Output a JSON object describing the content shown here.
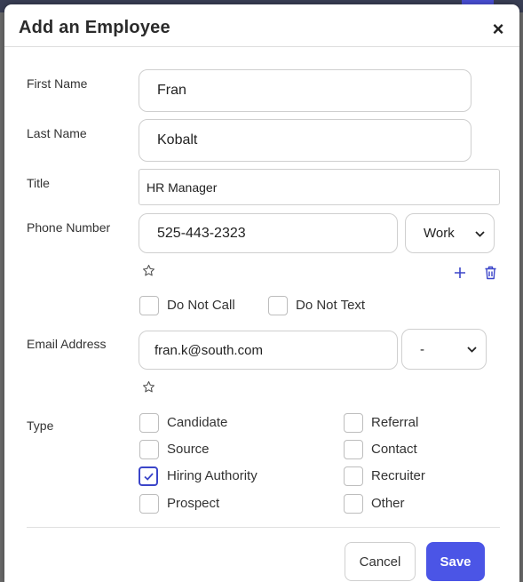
{
  "modal": {
    "title": "Add an Employee",
    "close_glyph": "×"
  },
  "fields": {
    "first_name": {
      "label": "First Name",
      "value": "Fran"
    },
    "last_name": {
      "label": "Last Name",
      "value": "Kobalt"
    },
    "title": {
      "label": "Title",
      "value": "HR Manager"
    },
    "phone": {
      "label": "Phone Number",
      "value": "525-443-2323",
      "type_selected": "Work"
    },
    "email": {
      "label": "Email Address",
      "value": "fran.k@south.com",
      "type_selected": "-"
    }
  },
  "phone_options": {
    "do_not_call": {
      "label": "Do Not Call",
      "checked": false
    },
    "do_not_text": {
      "label": "Do Not Text",
      "checked": false
    }
  },
  "type": {
    "label": "Type",
    "options": [
      {
        "label": "Candidate",
        "checked": false
      },
      {
        "label": "Referral",
        "checked": false
      },
      {
        "label": "Source",
        "checked": false
      },
      {
        "label": "Contact",
        "checked": false
      },
      {
        "label": "Hiring Authority",
        "checked": true
      },
      {
        "label": "Recruiter",
        "checked": false
      },
      {
        "label": "Prospect",
        "checked": false
      },
      {
        "label": "Other",
        "checked": false
      }
    ]
  },
  "footer": {
    "cancel_label": "Cancel",
    "save_label": "Save"
  },
  "colors": {
    "accent": "#4b55e6",
    "icon_accent": "#3b45c9"
  },
  "icons": {
    "star": "star-outline-icon",
    "add": "plus-icon",
    "delete": "trash-icon",
    "close": "close-icon",
    "dropdown": "chevron-down-icon",
    "check": "checkmark-icon"
  }
}
